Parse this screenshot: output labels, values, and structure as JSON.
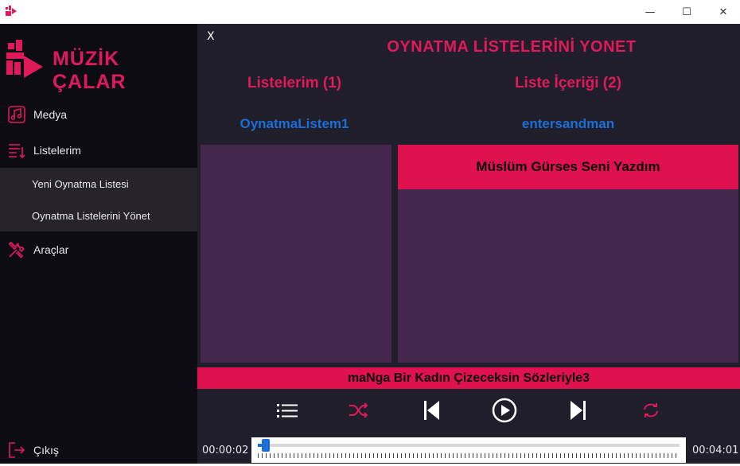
{
  "window": {
    "minimize_glyph": "—",
    "maximize_glyph": "☐",
    "close_glyph": "✕"
  },
  "brand": {
    "logo_text": "MÜZİK ÇALAR",
    "accent_color": "#e0195a"
  },
  "sidebar": {
    "items": [
      {
        "label": "Medya",
        "icon": "music-note-icon"
      },
      {
        "label": "Listelerim",
        "icon": "playlist-icon"
      },
      {
        "label": "Araçlar",
        "icon": "tools-icon"
      },
      {
        "label": "Çıkış",
        "icon": "exit-icon"
      }
    ],
    "subitems": [
      {
        "label": "Yeni Oynatma Listesi"
      },
      {
        "label": "Oynatma Listelerini Yönet"
      }
    ]
  },
  "main": {
    "close_label": "X",
    "title": "OYNATMA LİSTELERİNİ YONET",
    "left_column": {
      "heading": "Listelerim (1)",
      "selected": "OynatmaListem1"
    },
    "right_column": {
      "heading": "Liste İçeriği (2)",
      "selected": "entersandman",
      "songs": [
        "Müslüm Gürses Seni Yazdım"
      ]
    }
  },
  "player": {
    "now_playing": "maNga Bir Kadın Çizeceksin Sözleriyle3",
    "elapsed": "00:00:02",
    "duration": "00:04:01",
    "progress_fraction": 0.01,
    "buttons": [
      "list-icon",
      "shuffle-icon",
      "previous-icon",
      "play-icon",
      "next-icon",
      "repeat-icon"
    ]
  }
}
